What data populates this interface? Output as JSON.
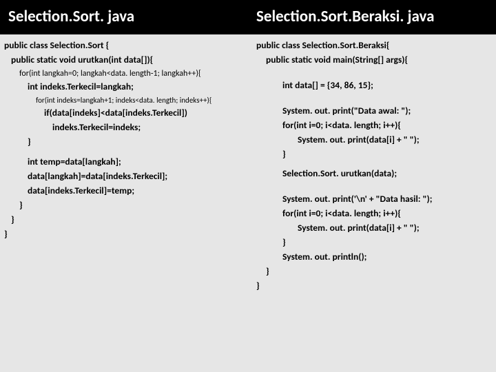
{
  "left": {
    "title": "Selection.Sort. java",
    "lines": {
      "l0": "public class Selection.Sort {",
      "l1": "public static void urutkan(int data[]){",
      "l2": "for(int langkah=0; langkah<data. length-1; langkah++){",
      "l3": "int indeks.Terkecil=langkah;",
      "l4": "for(int indeks=langkah+1; indeks<data. length; indeks++){",
      "l5": "if(data[indeks]<data[indeks.Terkecil])",
      "l6": "indeks.Terkecil=indeks;",
      "l7": "}",
      "l8": "int temp=data[langkah];",
      "l9": "data[langkah]=data[indeks.Terkecil];",
      "l10": "data[indeks.Terkecil]=temp;",
      "l11": "}",
      "l12": "}",
      "l13": "}"
    }
  },
  "right": {
    "title": "Selection.Sort.Beraksi. java",
    "lines": {
      "r0": "public class Selection.Sort.Beraksi{",
      "r1": "public static void main(String[] args){",
      "r2": "int data[] = {34, 86, 15};",
      "r3": "System. out. print(\"Data awal: \");",
      "r4": "for(int i=0; i<data. length; i++){",
      "r5": "System. out. print(data[i] + \" \");",
      "r6": "}",
      "r7": "Selection.Sort. urutkan(data);",
      "r8": "System. out. print('\\n' + \"Data hasil: \");",
      "r9": "for(int i=0; i<data. length; i++){",
      "r10": "System. out. print(data[i] + \" \");",
      "r11": "}",
      "r12": "System. out. println();",
      "r13": "}",
      "r14": "}"
    }
  }
}
